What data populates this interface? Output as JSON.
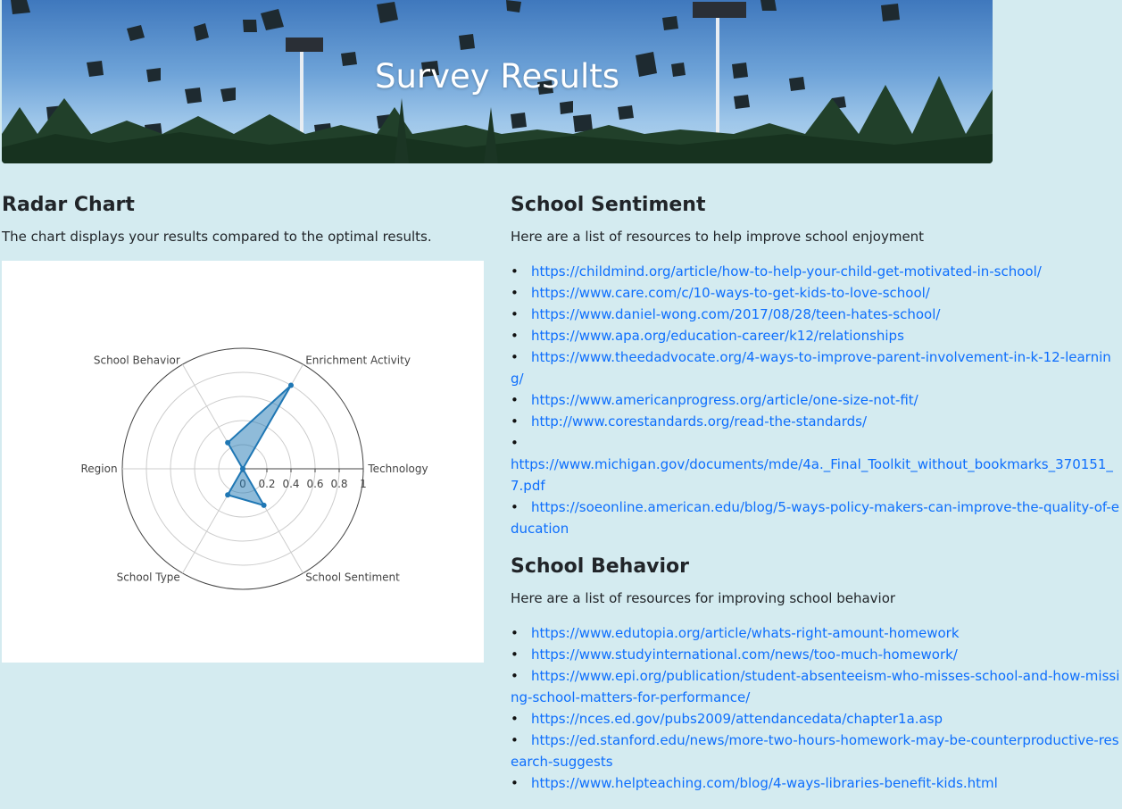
{
  "banner": {
    "title": "Survey Results"
  },
  "radar_section": {
    "heading": "Radar Chart",
    "description": "The chart displays your results compared to the optimal results."
  },
  "chart_data": {
    "type": "radar",
    "axes": [
      "Technology",
      "Enrichment Activity",
      "School Behavior",
      "Region",
      "School Type",
      "School Sentiment"
    ],
    "values": [
      0,
      0.8,
      0.25,
      0,
      0.25,
      0.35
    ],
    "radial_ticks": [
      "0",
      "0.2",
      "0.4",
      "0.6",
      "0.8",
      "1"
    ],
    "range": [
      0,
      1
    ],
    "colors": {
      "line": "#1f77b4",
      "fill": "#1f77b4",
      "grid": "#cccccc"
    }
  },
  "sentiment_section": {
    "heading": "School Sentiment",
    "description": "Here are a list of resources to help improve school enjoyment",
    "links": [
      "https://childmind.org/article/how-to-help-your-child-get-motivated-in-school/",
      "https://www.care.com/c/10-ways-to-get-kids-to-love-school/",
      "https://www.daniel-wong.com/2017/08/28/teen-hates-school/",
      "https://www.apa.org/education-career/k12/relationships",
      "https://www.theedadvocate.org/4-ways-to-improve-parent-involvement-in-k-12-learning/",
      "https://www.americanprogress.org/article/one-size-not-fit/",
      "http://www.corestandards.org/read-the-standards/",
      "https://www.michigan.gov/documents/mde/4a._Final_Toolkit_without_bookmarks_370151_7.pdf",
      "https://soeonline.american.edu/blog/5-ways-policy-makers-can-improve-the-quality-of-education"
    ]
  },
  "behavior_section": {
    "heading": "School Behavior",
    "description": "Here are a list of resources for improving school behavior",
    "links": [
      "https://www.edutopia.org/article/whats-right-amount-homework",
      "https://www.studyinternational.com/news/too-much-homework/",
      "https://www.epi.org/publication/student-absenteeism-who-misses-school-and-how-missing-school-matters-for-performance/",
      "https://nces.ed.gov/pubs2009/attendancedata/chapter1a.asp",
      "https://ed.stanford.edu/news/more-two-hours-homework-may-be-counterproductive-research-suggests",
      "https://www.helpteaching.com/blog/4-ways-libraries-benefit-kids.html"
    ]
  }
}
